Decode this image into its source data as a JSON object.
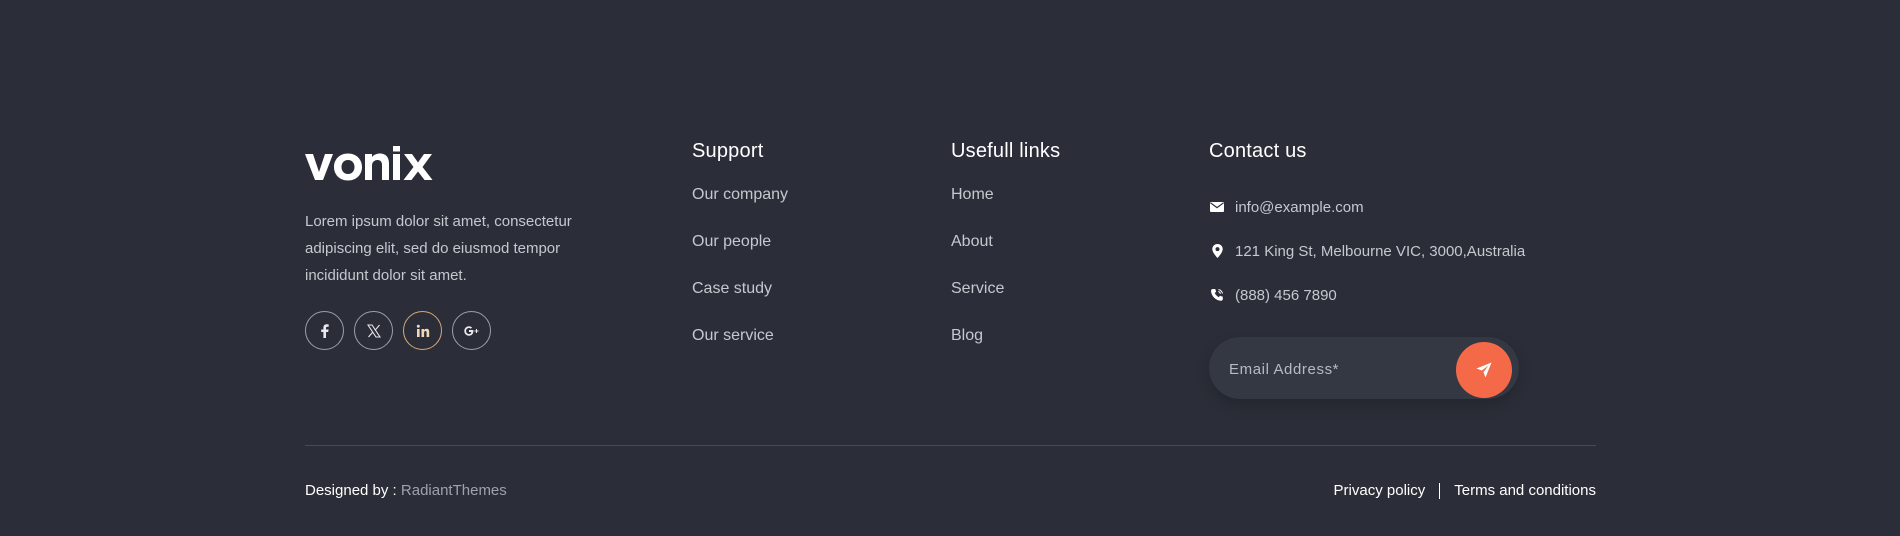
{
  "brand": {
    "logo_text": "vonix",
    "description": "Lorem ipsum dolor sit amet, consectetur adipiscing elit, sed do eiusmod tempor incididunt dolor sit amet.",
    "social": [
      {
        "icon": "facebook-icon"
      },
      {
        "icon": "x-twitter-icon"
      },
      {
        "icon": "linkedin-icon"
      },
      {
        "icon": "google-plus-icon"
      }
    ]
  },
  "support": {
    "title": "Support",
    "items": [
      "Our company",
      "Our people",
      "Case study",
      "Our service"
    ]
  },
  "useful_links": {
    "title": "Usefull links",
    "items": [
      "Home",
      "About",
      "Service",
      "Blog"
    ]
  },
  "contact": {
    "title": "Contact us",
    "email": "info@example.com",
    "address": "121 King St, Melbourne VIC, 3000,Australia",
    "phone": "(888) 456 7890",
    "subscribe": {
      "placeholder": "Email Address*",
      "button_icon": "paper-plane-icon"
    }
  },
  "bottom": {
    "designed_by_label": "Designed by : ",
    "designer": "RadiantThemes",
    "privacy": "Privacy policy",
    "terms": "Terms and conditions"
  },
  "colors": {
    "background": "#2b2e38",
    "accent": "#f46a49",
    "heading": "#ffffff",
    "text": "#c5c8cf"
  }
}
